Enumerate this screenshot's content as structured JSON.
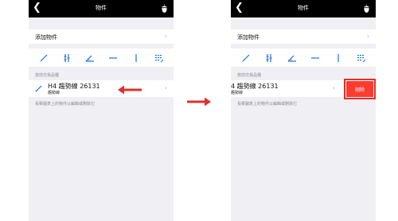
{
  "screens": [
    {
      "nav": {
        "back_icon": "chevron-left-icon",
        "title": "物件",
        "right_icon": "acorn-icon"
      },
      "add_row": {
        "label": "添加物件"
      },
      "tools": [
        "diagonal-line-icon",
        "channel-icon",
        "angle-icon",
        "horizontal-line-icon",
        "vertical-line-icon",
        "grid-icon"
      ],
      "section_title": "當前交易品種",
      "item": {
        "name": "H4 趨勢線 26131",
        "type": "趨勢線"
      },
      "hint": "長擊圖表上的物件以編輯或刪除它"
    },
    {
      "nav": {
        "back_icon": "chevron-left-icon",
        "title": "物件",
        "right_icon": "acorn-icon"
      },
      "add_row": {
        "label": "添加物件"
      },
      "tools": [
        "diagonal-line-icon",
        "channel-icon",
        "angle-icon",
        "horizontal-line-icon",
        "vertical-line-icon",
        "grid-icon"
      ],
      "section_title": "當前交易品種",
      "item": {
        "name": "4 趨勢線 26131",
        "type": "趨勢線"
      },
      "delete_label": "刪除",
      "hint": "長擊圖表上的物件以編輯或刪除它"
    }
  ],
  "annotations": {
    "arrow_color": "#e0302a"
  },
  "colors": {
    "navbar": "#000000",
    "background": "#efeff4",
    "delete": "#ff3b30",
    "accent": "#1e6fd9"
  }
}
